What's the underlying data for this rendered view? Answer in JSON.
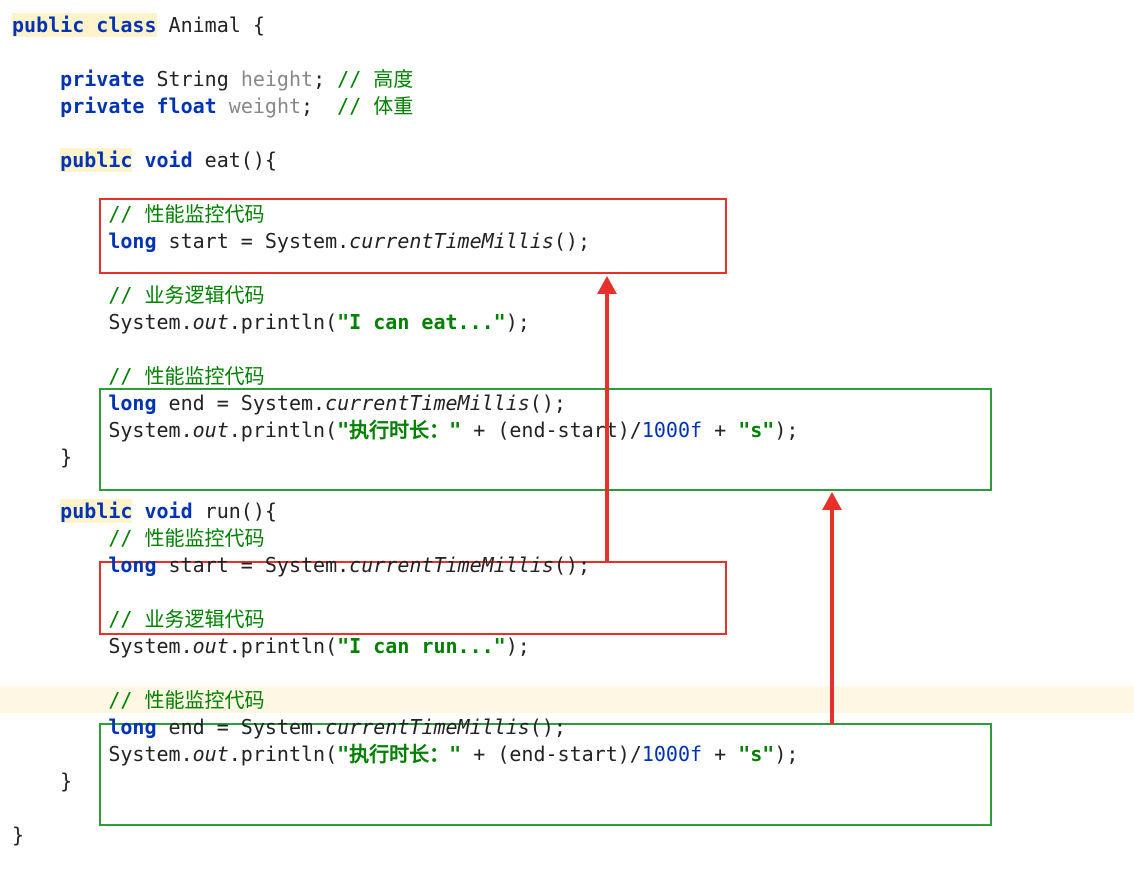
{
  "code": {
    "l1": {
      "a": "public",
      "b": "class",
      "c": " Animal {"
    },
    "l3a": "private",
    "l3b": "String",
    "l3c": "height",
    "l3d": ";",
    "l3e": "// 高度",
    "l4a": "private",
    "l4b": "float",
    "l4c": "weight",
    "l4d": ";",
    "l4e": "// 体重",
    "l6a": "public",
    "l6b": "void",
    "l6c": " eat(){",
    "mc1": "// 性能监控代码",
    "mc2a": "long",
    "mc2b": " start = System.",
    "mc2c": "currentTimeMillis",
    "mc2d": "();",
    "bl1": "// 业务逻辑代码",
    "bl2a": "System.",
    "bl2b": "out",
    "bl2c": ".println(",
    "bl2d": "\"I can eat...\"",
    "bl2e": ");",
    "mc3": "// 性能监控代码",
    "mc4a": "long",
    "mc4b": " end = System.",
    "mc4c": "currentTimeMillis",
    "mc4d": "();",
    "mc5a": "System.",
    "mc5b": "out",
    "mc5c": ".println(",
    "mc5d": "\"执行时长：\"",
    "mc5e": " + (end-start)/",
    "mc5f": "1000f",
    "mc5g": " + ",
    "mc5h": "\"s\"",
    "mc5i": ");",
    "close1": "}",
    "r1a": "public",
    "r1b": "void",
    "r1c": " run(){",
    "r_mc1": "// 性能监控代码",
    "r_mc2a": "long",
    "r_mc2b": " start = System.",
    "r_mc2c": "currentTimeMillis",
    "r_mc2d": "();",
    "r_bl1": "// 业务逻辑代码",
    "r_bl2a": "System.",
    "r_bl2b": "out",
    "r_bl2c": ".println(",
    "r_bl2d": "\"I can run...\"",
    "r_bl2e": ");",
    "r_mc3": "// 性能监控代码",
    "r_mc4a": "long",
    "r_mc4b": " end = System.",
    "r_mc4c": "currentTimeMillis",
    "r_mc4d": "();",
    "r_mc5a": "System.",
    "r_mc5b": "out",
    "r_mc5c": ".println(",
    "r_mc5d": "\"执行时长：\"",
    "r_mc5e": " + (end-start)/",
    "r_mc5f": "1000f",
    "r_mc5g": " + ",
    "r_mc5h": "\"s\"",
    "r_mc5i": ");",
    "close2": "}",
    "close3": "}"
  }
}
